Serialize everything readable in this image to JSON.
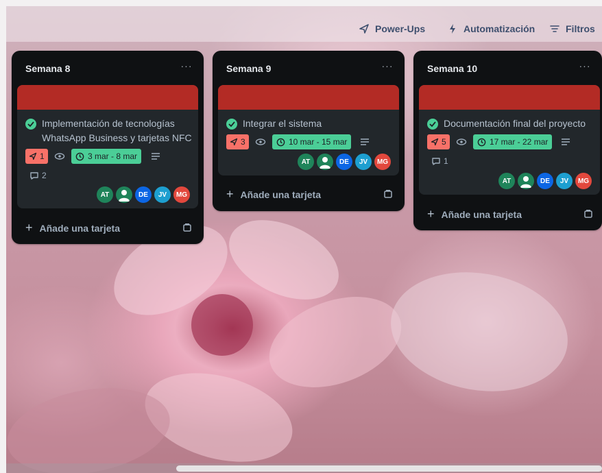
{
  "toolbar": {
    "powerups_label": "Power-Ups",
    "automation_label": "Automatización",
    "filters_label": "Filtros"
  },
  "lists": [
    {
      "title": "Semana 8",
      "menu": "···",
      "card": {
        "title_line1": "Implementación de tecnologías",
        "title_line2": "WhatsApp Business y tarjetas NFC",
        "cover_color": "#b32b25",
        "pin_count": "1",
        "date_range": "3 mar - 8 mar",
        "comment_count": "2",
        "members": [
          "AT",
          "",
          "DE",
          "JV",
          "MG"
        ]
      },
      "add_label": "Añade una tarjeta"
    },
    {
      "title": "Semana 9",
      "menu": "···",
      "card": {
        "title_line1": "Integrar el sistema",
        "cover_color": "#b32b25",
        "pin_count": "3",
        "date_range": "10 mar - 15 mar",
        "members": [
          "AT",
          "",
          "DE",
          "JV",
          "MG"
        ]
      },
      "add_label": "Añade una tarjeta"
    },
    {
      "title": "Semana 10",
      "menu": "···",
      "card": {
        "title_line1": "Documentación final del proyecto",
        "cover_color": "#b32b25",
        "pin_count": "5",
        "date_range": "17 mar - 22 mar",
        "comment_count": "1",
        "members": [
          "AT",
          "",
          "DE",
          "JV",
          "MG"
        ]
      },
      "add_label": "Añade una tarjeta"
    }
  ],
  "colors": {
    "member_AT": "#1f845a",
    "member_user": "#1f845a",
    "member_DE": "#0c66e4",
    "member_JV": "#1d9fd0",
    "member_MG": "#e2483d",
    "date_badge": "#4bce97",
    "pin_badge": "#f87168"
  }
}
